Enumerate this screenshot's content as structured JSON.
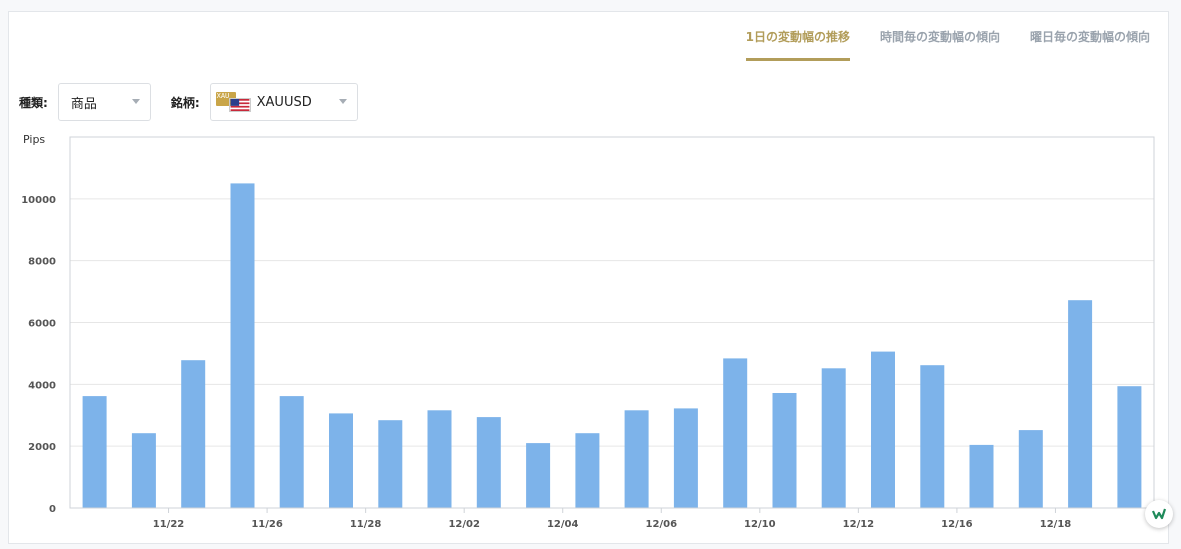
{
  "tabs": [
    {
      "label": "1日の変動幅の推移",
      "active": true
    },
    {
      "label": "時間毎の変動幅の傾向",
      "active": false
    },
    {
      "label": "曜日毎の変動幅の傾向",
      "active": false
    }
  ],
  "filters": {
    "kind_label": "種類:",
    "kind_value": "商品",
    "symbol_label": "銘柄:",
    "symbol_value": "XAUUSD",
    "symbol_badge": "XAU"
  },
  "colors": {
    "bar": "#7db3ea",
    "accent": "#b29d5a",
    "grid": "#e6e6e6",
    "tab_inactive": "#9aa3ad"
  },
  "chart_data": {
    "type": "bar",
    "ylabel": "Pips",
    "ylim": [
      0,
      12000
    ],
    "yticks": [
      0,
      2000,
      4000,
      6000,
      8000,
      10000
    ],
    "xtick_labels": [
      "11/22",
      "11/26",
      "11/28",
      "12/02",
      "12/04",
      "12/06",
      "12/10",
      "12/12",
      "12/16",
      "12/18"
    ],
    "values": [
      3620,
      2420,
      4780,
      10500,
      3620,
      3060,
      2840,
      3160,
      2940,
      2100,
      2420,
      3160,
      3220,
      4840,
      3720,
      4520,
      5060,
      4620,
      2040,
      2520,
      6720,
      3940
    ]
  }
}
